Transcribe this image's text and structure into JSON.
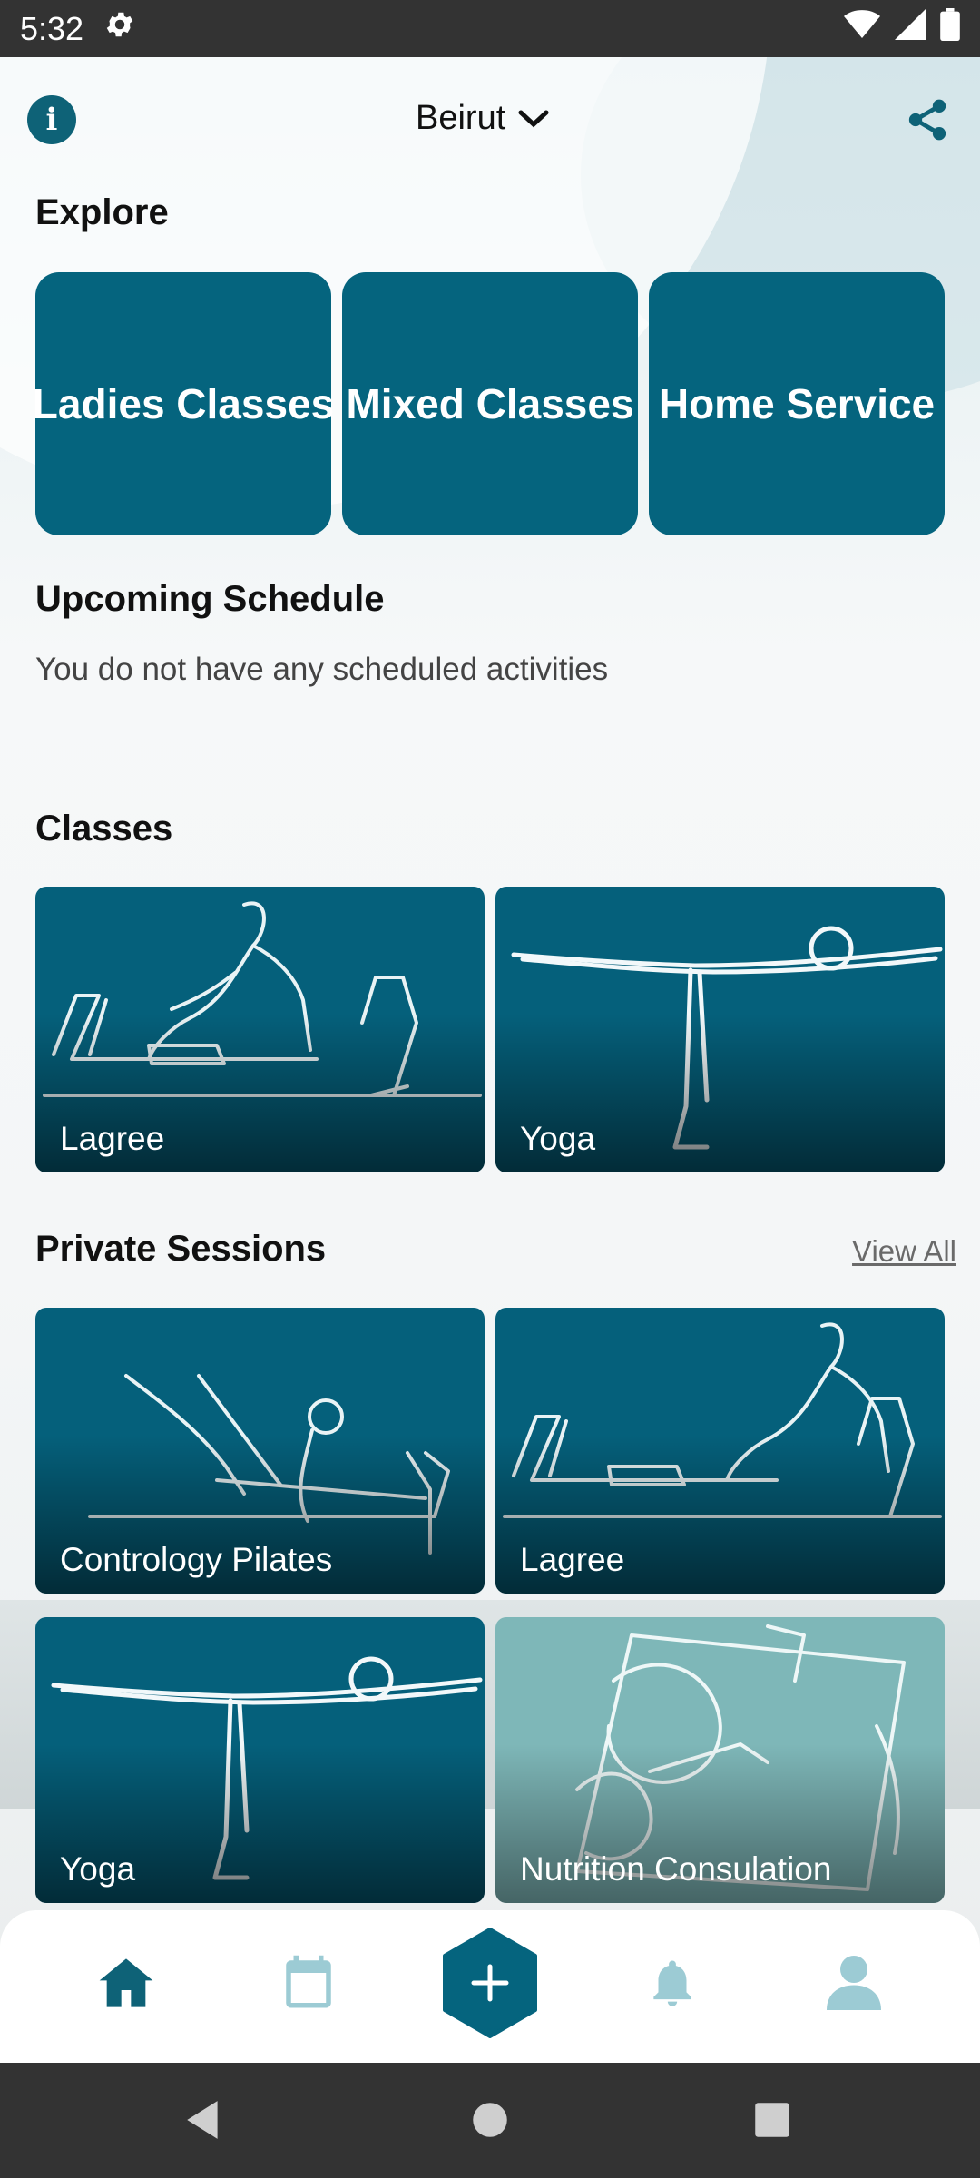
{
  "status_bar": {
    "time": "5:32",
    "icons": [
      "settings-gear-icon",
      "wifi-icon",
      "cellular-signal-icon",
      "battery-icon"
    ]
  },
  "header": {
    "city": "Beirut",
    "info_icon": "info-icon",
    "share_icon": "share-icon"
  },
  "explore": {
    "title": "Explore",
    "items": [
      "Ladies Classes",
      "Mixed Classes",
      "Home Service"
    ]
  },
  "upcoming": {
    "title": "Upcoming Schedule",
    "empty_text": "You do not have any scheduled activities"
  },
  "classes": {
    "title": "Classes",
    "items": [
      "Lagree",
      "Yoga"
    ]
  },
  "private_sessions": {
    "title": "Private Sessions",
    "view_all": "View All",
    "items": [
      "Contrology Pilates",
      "Lagree",
      "Yoga",
      "Nutrition Consulation"
    ]
  },
  "bottom_nav": {
    "items": [
      "home-icon",
      "calendar-icon",
      "add-icon",
      "bell-icon",
      "profile-icon"
    ],
    "active": "home-icon"
  },
  "colors": {
    "primary": "#05647e",
    "light_card": "#7eb7b8",
    "inactive_icon": "#9ccbd4"
  }
}
